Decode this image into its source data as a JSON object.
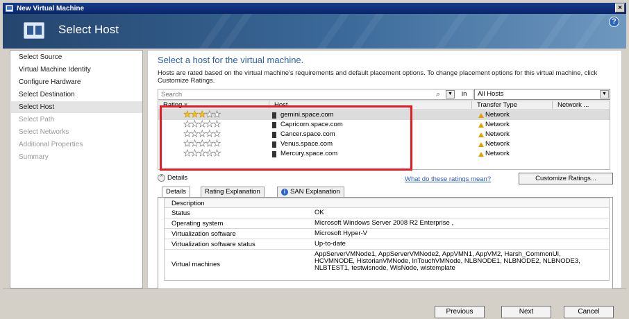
{
  "window": {
    "title": "New Virtual Machine",
    "close_glyph": "×"
  },
  "header": {
    "title": "Select Host",
    "help_glyph": "?"
  },
  "sidebar": {
    "items": [
      {
        "label": "Select Source"
      },
      {
        "label": "Virtual Machine Identity"
      },
      {
        "label": "Configure Hardware"
      },
      {
        "label": "Select Destination"
      },
      {
        "label": "Select Host"
      },
      {
        "label": "Select Path"
      },
      {
        "label": "Select Networks"
      },
      {
        "label": "Additional Properties"
      },
      {
        "label": "Summary"
      }
    ]
  },
  "main": {
    "heading": "Select a host for the virtual machine.",
    "description": "Hosts are rated based on the virtual machine's requirements and default placement options. To change placement options for this virtual machine, click Customize Ratings.",
    "search_placeholder": "Search",
    "in_label": "in",
    "host_filter": "All Hosts",
    "columns": {
      "rating": "Rating",
      "host": "Host",
      "transfer": "Transfer Type",
      "network": "Network ..."
    },
    "hosts": [
      {
        "name": "gemini.space.com",
        "rating": 3,
        "transfer": "Network"
      },
      {
        "name": "Capricorn.space.com",
        "rating": 0,
        "transfer": "Network"
      },
      {
        "name": "Cancer.space.com",
        "rating": 0,
        "transfer": "Network"
      },
      {
        "name": "Venus.space.com",
        "rating": 0,
        "transfer": "Network"
      },
      {
        "name": "Mercury.space.com",
        "rating": 0,
        "transfer": "Network"
      }
    ],
    "details_label": "Details",
    "ratings_link": "What do these ratings mean?",
    "customize_button": "Customize Ratings...",
    "tabs": [
      "Details",
      "Rating Explanation",
      "SAN Explanation"
    ],
    "details": {
      "description_header": "Description",
      "rows": [
        {
          "key": "Status",
          "value": "OK"
        },
        {
          "key": "Operating system",
          "value": "Microsoft Windows Server 2008 R2 Enterprise ,"
        },
        {
          "key": "Virtualization software",
          "value": "Microsoft Hyper-V"
        },
        {
          "key": "Virtualization software status",
          "value": "Up-to-date"
        },
        {
          "key": "Virtual machines",
          "value": "AppServerVMNode1, AppServerVMNode2, AppVMN1, AppVM2, Harsh_CommonUI, HCVMNODE, HistorianVMNode, InTouchVMNode, NLBNODE1, NLBNODE2, NLBNODE3, NLBTEST1, testwisnode, WisNode, wistemplate"
        }
      ]
    }
  },
  "footer": {
    "previous": "Previous",
    "next": "Next",
    "cancel": "Cancel"
  }
}
